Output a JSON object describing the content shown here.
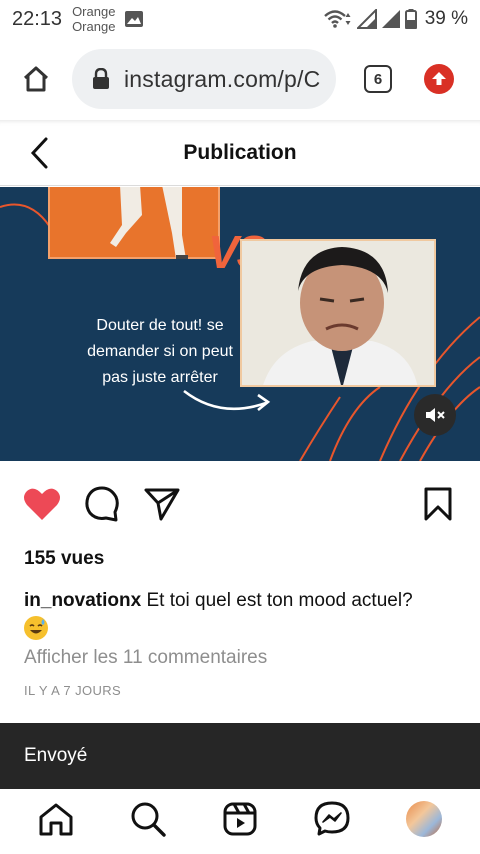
{
  "status_bar": {
    "time": "22:13",
    "carrier_line1": "Orange",
    "carrier_line2": "Orange",
    "battery": "39 %"
  },
  "browser": {
    "url": "instagram.com/p/C",
    "tab_count": "6"
  },
  "header": {
    "title": "Publication"
  },
  "media": {
    "vs_label": "VS",
    "caption_lines": [
      "Douter de tout! se",
      "demander si on peut",
      "pas juste arrêter"
    ]
  },
  "post": {
    "views": "155 vues",
    "username": "in_novationx",
    "caption": "Et toi quel est ton mood actuel?",
    "view_comments": "Afficher les 11 commentaires",
    "age": "IL Y A 7 JOURS"
  },
  "snackbar": {
    "text": "Envoyé"
  },
  "colors": {
    "like_red": "#ed4956",
    "media_bg": "#163a5a",
    "accent_orange": "#e8742c",
    "browser_upload_red": "#d93025"
  }
}
